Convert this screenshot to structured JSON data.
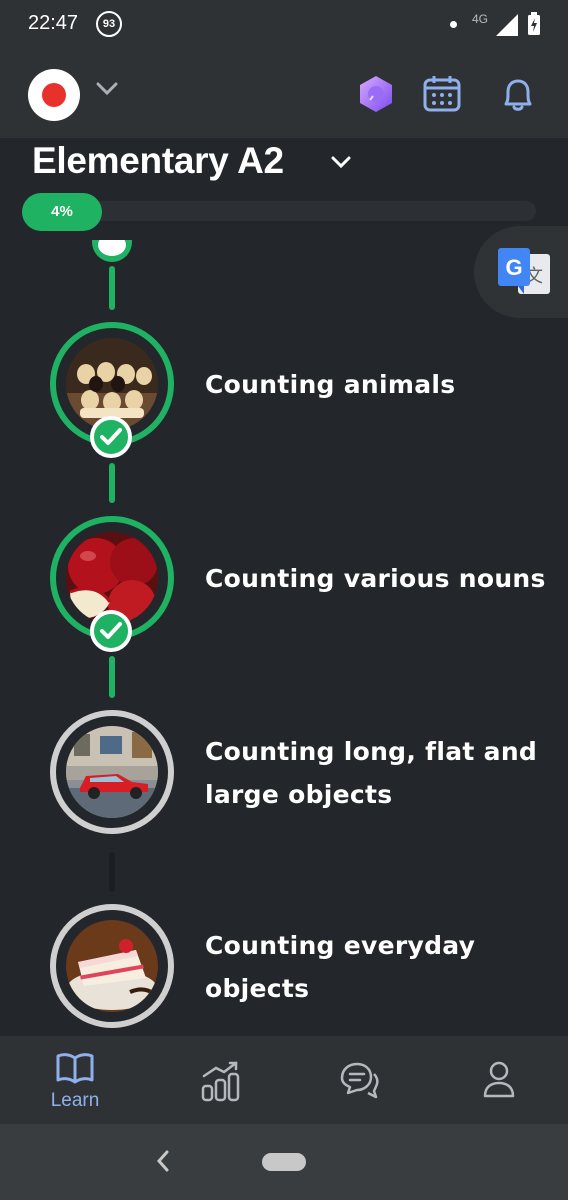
{
  "status_bar": {
    "time": "22:47",
    "notification_count": "93",
    "network": "4G"
  },
  "header": {
    "avatar_icon": "japan-flag-icon",
    "dropdown_icon": "chevron-down-icon",
    "actions": [
      "premium-gem-icon",
      "calendar-icon",
      "bell-icon"
    ]
  },
  "level": {
    "title": "Elementary A2",
    "progress_label": "4%",
    "progress_value": 0.04
  },
  "lessons": [
    {
      "title": "Counting animals",
      "status": "completed",
      "image": "puppies"
    },
    {
      "title": "Counting various nouns",
      "status": "completed",
      "image": "red apples"
    },
    {
      "title": "Counting long, flat and large objects",
      "status": "locked",
      "image": "red car"
    },
    {
      "title": "Counting everyday objects",
      "status": "locked",
      "image": "cake slice"
    }
  ],
  "bottom_nav": {
    "items": [
      {
        "label": "Learn",
        "icon": "book-icon",
        "active": true
      },
      {
        "label": "",
        "icon": "stats-icon",
        "active": false
      },
      {
        "label": "",
        "icon": "chat-icon",
        "active": false
      },
      {
        "label": "",
        "icon": "profile-icon",
        "active": false
      }
    ]
  },
  "colors": {
    "accent_green": "#1fb262",
    "background": "#23272b",
    "active_nav": "#8fb0ea"
  }
}
